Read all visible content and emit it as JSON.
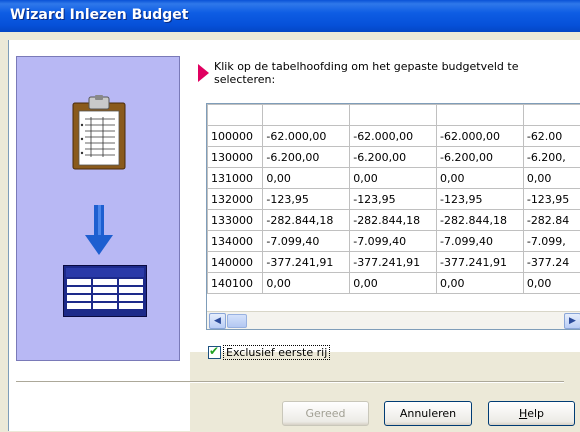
{
  "window": {
    "title": "Wizard Inlezen Budget"
  },
  "instruction": "Klik op de tabelhoofding om het gepaste budgetveld te selecteren:",
  "grid": {
    "headers": [
      "",
      "",
      "",
      "",
      ""
    ],
    "rows": [
      [
        "100000",
        "-62.000,00",
        "-62.000,00",
        "-62.000,00",
        "-62.00"
      ],
      [
        "130000",
        "-6.200,00",
        "-6.200,00",
        "-6.200,00",
        "-6.200,"
      ],
      [
        "131000",
        "0,00",
        "0,00",
        "0,00",
        "0,00"
      ],
      [
        "132000",
        "-123,95",
        "-123,95",
        "-123,95",
        "-123,95"
      ],
      [
        "133000",
        "-282.844,18",
        "-282.844,18",
        "-282.844,18",
        "-282.84"
      ],
      [
        "134000",
        "-7.099,40",
        "-7.099,40",
        "-7.099,40",
        "-7.099,"
      ],
      [
        "140000",
        "-377.241,91",
        "-377.241,91",
        "-377.241,91",
        "-377.24"
      ],
      [
        "140100",
        "0,00",
        "0,00",
        "0,00",
        "0,00"
      ]
    ]
  },
  "checkbox": {
    "label": "Exclusief eerste rij",
    "checked": true
  },
  "buttons": {
    "finish": "Gereed",
    "cancel": "Annuleren",
    "help": "Help"
  },
  "icons": {
    "clipboard": "clipboard-icon",
    "arrow": "arrow-down-icon",
    "table": "table-icon",
    "pointer": "pointer-arrow-icon"
  },
  "colors": {
    "titlebar": "#0a52d6",
    "panel": "#b8b8f4",
    "pointer": "#e00060",
    "arrow": "#1e5fd0"
  }
}
